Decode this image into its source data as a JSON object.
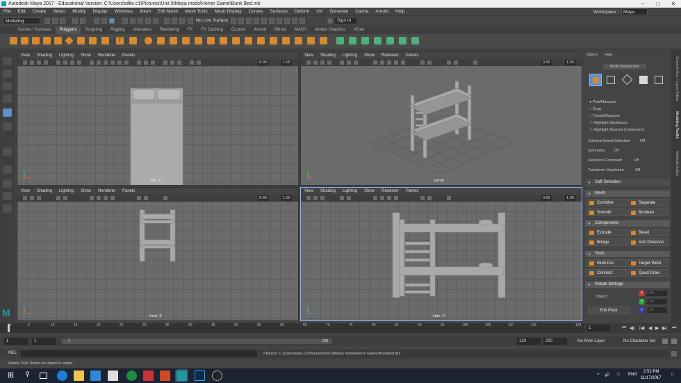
{
  "window": {
    "title": "Autodesk Maya 2017 - Educational Version: C:\\Users\\silke.c1\\Pictures\\Unit 9\\Maya mods\\Horror Game\\Bunk Bed.mb",
    "controls": [
      "–",
      "□",
      "✕"
    ]
  },
  "menubar": {
    "items": [
      "File",
      "Edit",
      "Create",
      "Select",
      "Modify",
      "Display",
      "Windows",
      "Mesh",
      "Edit Mesh",
      "Mesh Tools",
      "Mesh Display",
      "Curves",
      "Surfaces",
      "Deform",
      "UV",
      "Generate",
      "Cache",
      "Arnold",
      "Help"
    ],
    "workspace_label": "Workspace :",
    "workspace_value": "Maya Classic"
  },
  "statusline": {
    "mode": "Modeling",
    "live_surface": "No Live Surface",
    "sign_in": "Sign In"
  },
  "shelf": {
    "tabs": [
      "Curves / Surfaces",
      "Polygons",
      "Sculpting",
      "Rigging",
      "Animation",
      "Rendering",
      "FX",
      "FX Caching",
      "Custom",
      "Arnold",
      "Bifrost",
      "MASH",
      "Motion Graphics",
      "XGen"
    ],
    "active_tab": "Polygons"
  },
  "viewport_menu": [
    "View",
    "Shading",
    "Lighting",
    "Show",
    "Renderer",
    "Panels"
  ],
  "viewports": [
    {
      "label": "top -Y",
      "num_a": "0.00",
      "num_b": "1.00"
    },
    {
      "label": "persp",
      "num_a": "0.00",
      "num_b": "1.00"
    },
    {
      "label": "front -Z",
      "num_a": "0.00",
      "num_b": "1.00"
    },
    {
      "label": "side -X",
      "num_a": "0.00",
      "num_b": "1.00"
    }
  ],
  "rightpanel": {
    "menu": [
      "Object",
      "Help"
    ],
    "mode": "Multi-Component",
    "options": [
      "Pick/Marquee",
      "Drag",
      "Tweak/Marquee",
      "Highlight Backfaces",
      "Highlight Nearest Component"
    ],
    "camera_based": "Camera Based Selection",
    "camera_based_val": "Off",
    "symmetry": "Symmetry",
    "symmetry_val": "Off",
    "sel_constraint": "Selection Constraint",
    "sel_constraint_val": "Off",
    "xform_constraint": "Transform Constraint",
    "xform_constraint_val": "Off",
    "soft_selection": "Soft Selection",
    "sections": {
      "mesh": "Mesh",
      "components": "Components",
      "tools": "Tools",
      "rotate": "Rotate Settings"
    },
    "mesh_buttons": [
      "Combine",
      "Separate",
      "Smooth",
      "Boolean"
    ],
    "component_buttons": [
      "Extrude",
      "Bevel",
      "Bridge",
      "Add Divisions"
    ],
    "tool_buttons": [
      "Multi-Cut",
      "Target Weld",
      "Connect",
      "Quad Draw"
    ],
    "object_label": "Object",
    "edit_pivot": "Edit Pivot",
    "axes": [
      "X",
      "Y",
      "Z"
    ],
    "axis_value": "0.00"
  },
  "sidetabs": [
    "Channel Box / Layer Editor",
    "Modeling Toolkit",
    "Attribute Editor"
  ],
  "timeslider": {
    "ticks": [
      "1",
      "5",
      "10",
      "15",
      "20",
      "25",
      "30",
      "35",
      "40",
      "45",
      "50",
      "55",
      "60",
      "65",
      "70",
      "75",
      "80",
      "85",
      "90",
      "95",
      "100",
      "105",
      "110",
      "115",
      "120"
    ],
    "current": "1"
  },
  "rangeslider": {
    "start": "1",
    "inner_start": "1",
    "range_start_label": "1",
    "range_end_label": "120",
    "end": "120",
    "anim_end": "200",
    "anim_layer": "No Anim Layer",
    "char_set": "No Character Set"
  },
  "cmdline": {
    "label": "MEL",
    "result": "// Result: C:/Users/silke.c1/Pictures/Unit 9/Maya mods/Horror Game/BunkBed.fbx"
  },
  "helpline": "Rotate Tool: Select an object to rotate.",
  "taskbar": {
    "time": "2:52 PM",
    "date": "11/17/2017",
    "lang": "ENG"
  },
  "colors": {
    "accent": "#5d8fc9",
    "shelf_orange": "#d68a30",
    "shelf_green": "#4fb07a",
    "maya_teal": "#1c9aa0"
  }
}
